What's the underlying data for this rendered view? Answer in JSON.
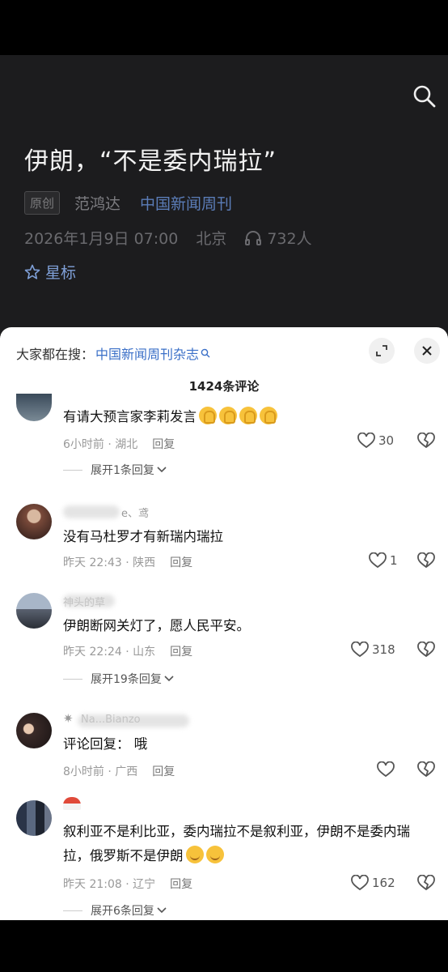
{
  "article": {
    "title": "伊朗，“不是委内瑞拉”",
    "badge": "原创",
    "author": "范鸿达",
    "source": "中国新闻周刊",
    "datetime": "2026年1月9日 07:00",
    "location": "北京",
    "listeners": "732人",
    "star_label": "星标"
  },
  "sheet": {
    "search_prefix": "大家都在搜：",
    "search_keyword": "中国新闻周刊杂志",
    "comment_count": "1424条评论"
  },
  "comments": [
    {
      "text": "有请大预言家李莉发言",
      "time": "6小时前 · 湖北",
      "reply": "回复",
      "likes": "30",
      "expand": "展开1条回复"
    },
    {
      "name": "e、鸢",
      "text": "没有马杜罗才有新瑞内瑞拉",
      "time": "昨天 22:43 · 陕西",
      "reply": "回复",
      "likes": "1"
    },
    {
      "name": "神头的草",
      "text": "伊朗断网关灯了，愿人民平安。",
      "time": "昨天 22:24 · 山东",
      "reply": "回复",
      "likes": "318",
      "expand": "展开19条回复"
    },
    {
      "name": "Na...Bianzo",
      "text": "评论回复： 哦",
      "time": "8小时前 · 广西",
      "reply": "回复",
      "likes": ""
    },
    {
      "text": "叙利亚不是利比亚，委内瑞拉不是叙利亚，伊朗不是委内瑞拉，俄罗斯不是伊朗",
      "time": "昨天 21:08 · 辽宁",
      "reply": "回复",
      "likes": "162",
      "expand": "展开6条回复"
    }
  ],
  "icons": {
    "search": "search-icon",
    "headphones": "headphones-icon",
    "star": "star-icon",
    "expand": "expand-icon",
    "close": "close-icon",
    "like": "heart-icon",
    "dislike": "broken-heart-icon",
    "chevron": "chevron-down-icon"
  },
  "colors": {
    "article_bg": "#1c1c1e",
    "source_link": "#5b7db8",
    "search_keyword": "#3a6fc7"
  }
}
